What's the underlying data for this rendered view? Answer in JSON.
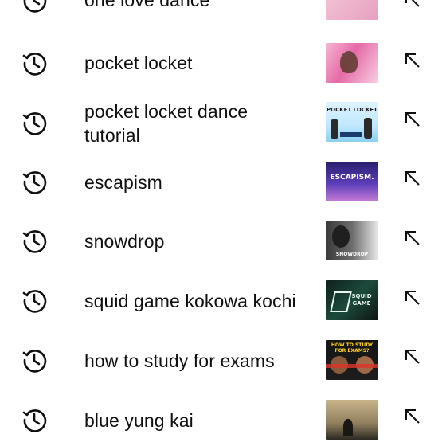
{
  "suggestions": [
    {
      "text": "one love dance",
      "thumb": {
        "bg": "linear-gradient(135deg,#f5c9d8,#e7a0c0)",
        "caption": "",
        "caption_color": "#ffffff"
      }
    },
    {
      "text": "pocket locket",
      "thumb": {
        "bg": "linear-gradient(120deg,#f7b6d2 0%,#e56aa7 45%,#f8d0e1 100%)",
        "caption": "",
        "caption_color": "#ffffff"
      }
    },
    {
      "text": "pocket locket dance tutorial",
      "thumb": {
        "bg": "linear-gradient(180deg,#dff3ff 0%,#bfe8ff 60%,#8bd0f0 100%)",
        "caption": "POCKET LOCKET",
        "caption_color": "#1a1a1a"
      }
    },
    {
      "text": "escapism",
      "thumb": {
        "bg": "linear-gradient(180deg,#2a1d6e 0%,#5b3fb8 55%,#c67bd6 100%)",
        "caption": "ESCAPISM.",
        "caption_color": "#ffffff"
      }
    },
    {
      "text": "snowdrop",
      "thumb": {
        "bg": "linear-gradient(90deg,#3a3a3a 0%,#6c6c6c 50%,#eaeaea 100%)",
        "caption": "SNOWDROP",
        "caption_color": "#ffffff"
      }
    },
    {
      "text": "squid game kokowa kochi",
      "thumb": {
        "bg": "linear-gradient(135deg,#0e1f1b 0%,#1d4a3c 50%,#0d1613 100%)",
        "caption": "SQUID GAME",
        "caption_color": "#e8f6ef"
      }
    },
    {
      "text": "how to study for exams",
      "thumb": {
        "bg": "linear-gradient(180deg,#151515 0%,#1d1d1d 100%)",
        "caption": "HOW TO STUDY FOR EXAMS?",
        "caption_color": "#ffd21f"
      }
    },
    {
      "text": "blue yung kai",
      "thumb": {
        "bg": "linear-gradient(180deg,#c9b48a 0%,#8f7d5c 60%,#2d2a24 100%)",
        "caption": "",
        "caption_color": "#ffffff"
      }
    }
  ],
  "icons": {
    "history": "history-icon",
    "fill_query": "arrow-up-left-icon"
  }
}
